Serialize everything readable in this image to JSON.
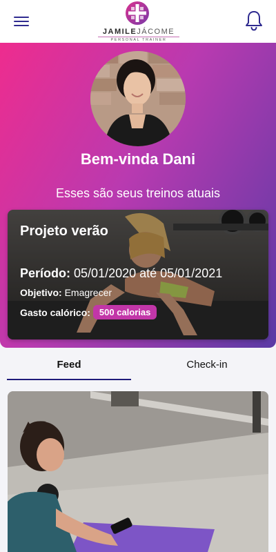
{
  "header": {
    "logo": {
      "first_name": "JAMILE",
      "last_name": "JÁCOME",
      "tagline": "PERSONAL TRAINER"
    },
    "menu_icon": "menu-icon",
    "notification_icon": "bell-icon"
  },
  "hero": {
    "greeting": "Bem-vinda Dani",
    "subtitle": "Esses são seus treinos atuais"
  },
  "workout": {
    "title": "Projeto verão",
    "period_label": "Período:",
    "period_value": "05/01/2020 até 05/01/2021",
    "goal_label": "Objetivo:",
    "goal_value": "Emagrecer",
    "calories_label": "Gasto calórico:",
    "calories_value": "500 calorias"
  },
  "tabs": [
    {
      "label": "Feed",
      "active": true
    },
    {
      "label": "Check-in",
      "active": false
    }
  ],
  "colors": {
    "brand_primary": "#2e2a8f",
    "gradient_start": "#ee2c8e",
    "gradient_end": "#5a3aa5",
    "badge": "#c236a8"
  }
}
